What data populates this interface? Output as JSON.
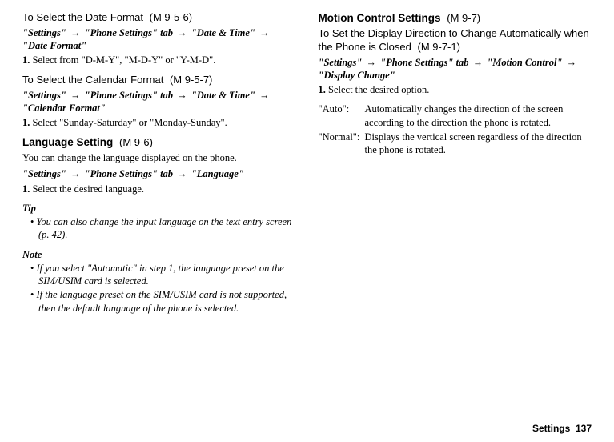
{
  "left": {
    "h1": {
      "title": "To Select the Date Format",
      "code": "(M 9-5-6)"
    },
    "path1": {
      "p1": "\"Settings\"",
      "a1": "→",
      "p2": "\"Phone Settings\" tab",
      "a2": "→",
      "p3": "\"Date & Time\"",
      "a3": "→",
      "p4": "\"Date Format\""
    },
    "step1_num": "1.",
    "step1_text": "Select from \"D-M-Y\", \"M-D-Y\" or \"Y-M-D\".",
    "h2": {
      "title": "To Select the Calendar Format",
      "code": "(M 9-5-7)"
    },
    "path2": {
      "p1": "\"Settings\"",
      "a1": "→",
      "p2": "\"Phone Settings\" tab",
      "a2": "→",
      "p3": "\"Date & Time\"",
      "a3": "→",
      "p4": "\"Calendar Format\""
    },
    "step2_num": "1.",
    "step2_text": "Select \"Sunday-Saturday\" or \"Monday-Sunday\".",
    "h3": {
      "title": "Language Setting",
      "code": "(M 9-6)"
    },
    "lang_body": "You can change the language displayed on the phone.",
    "path3": {
      "p1": "\"Settings\"",
      "a1": "→",
      "p2": "\"Phone Settings\" tab",
      "a2": "→",
      "p3": "\"Language\""
    },
    "step3_num": "1.",
    "step3_text": "Select the desired language.",
    "tip_label": "Tip",
    "tip1": "You can also change the input language on the text entry screen (p. 42).",
    "note_label": "Note",
    "note1": "If you select \"Automatic\" in step 1, the language preset on the SIM/USIM card is selected.",
    "note2": "If the language preset on the SIM/USIM card is not supported, then the default language of the phone is selected."
  },
  "right": {
    "h1": {
      "title": "Motion Control Settings",
      "code": "(M 9-7)"
    },
    "body_line1": "To Set the Display Direction to Change Automatically when the Phone is Closed",
    "body_code": "(M 9-7-1)",
    "path1": {
      "p1": "\"Settings\"",
      "a1": "→",
      "p2": "\"Phone Settings\" tab",
      "a2": "→",
      "p3": "\"Motion Control\"",
      "a3": "→",
      "p4": "\"Display Change\""
    },
    "step1_num": "1.",
    "step1_text": "Select the desired option.",
    "def1_term": "\"Auto\":",
    "def1_desc": "Automatically changes the direction of the screen according to the direction the phone is rotated.",
    "def2_term": "\"Normal\":",
    "def2_desc": "Displays the vertical screen regardless of the direction the phone is rotated."
  },
  "footer": {
    "section": "Settings",
    "page": "137"
  }
}
